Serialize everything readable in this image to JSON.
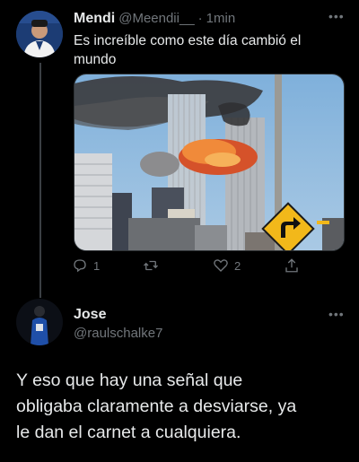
{
  "tweet": {
    "author_name": "Mendi",
    "handle": "@Meendii__",
    "separator": "·",
    "time": "1min",
    "text_line1": "Es increíble como este día cambió el",
    "text_line2": "mundo",
    "more_icon": "more-dots-icon",
    "actions": {
      "reply_count": "1",
      "retweet_count": "",
      "like_count": "2"
    },
    "media_description_icon": "twin-towers-photo"
  },
  "reply": {
    "author_name": "Jose",
    "handle": "@raulschalke7",
    "more_icon": "more-dots-icon",
    "text_line1": "Y eso que hay una señal que",
    "text_line2": "obligaba claramente a desviarse, ya",
    "text_line3": "le dan el carnet a cualquiera."
  },
  "colors": {
    "background": "#000000",
    "text": "#e7e9ea",
    "muted": "#71767b",
    "sky": "#87b3d6",
    "sign_yellow": "#f2b81a"
  }
}
